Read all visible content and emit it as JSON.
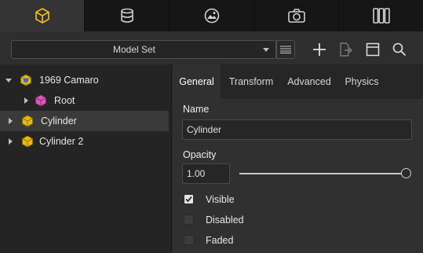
{
  "top_tabs": [
    {
      "icon": "cube-icon",
      "active": true
    },
    {
      "icon": "database-icon",
      "active": false
    },
    {
      "icon": "image-icon",
      "active": false
    },
    {
      "icon": "camera-icon",
      "active": false
    },
    {
      "icon": "columns-icon",
      "active": false
    }
  ],
  "toolbar": {
    "model_select_value": "Model Set",
    "icons": [
      "list-icon",
      "add-icon",
      "export-icon",
      "panel-icon",
      "search-icon"
    ]
  },
  "tree": {
    "items": [
      {
        "label": "1969 Camaro",
        "expanded": true,
        "icon": "model-cube-icon",
        "color": "#f0c020"
      },
      {
        "label": "Root",
        "expanded": false,
        "icon": "node-cube-icon",
        "color": "#e060c0"
      },
      {
        "label": "Cylinder",
        "expanded": false,
        "icon": "node-cube-icon",
        "color": "#f0c020",
        "selected": true
      },
      {
        "label": "Cylinder 2",
        "expanded": false,
        "icon": "node-cube-icon",
        "color": "#f0c020"
      }
    ]
  },
  "properties": {
    "tabs": [
      "General",
      "Transform",
      "Advanced",
      "Physics"
    ],
    "active_tab": "General",
    "name_label": "Name",
    "name_value": "Cylinder",
    "opacity_label": "Opacity",
    "opacity_value": "1.00",
    "opacity_fraction": 1.0,
    "checkboxes": [
      {
        "label": "Visible",
        "checked": true
      },
      {
        "label": "Disabled",
        "checked": false
      },
      {
        "label": "Faded",
        "checked": false
      }
    ]
  },
  "colors": {
    "accent": "#f0c020",
    "background": "#2b2b2b"
  }
}
